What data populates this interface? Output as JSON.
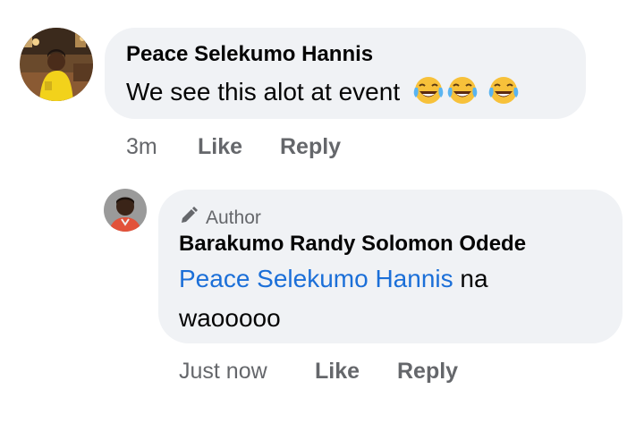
{
  "comment": {
    "author": "Peace Selekumo Hannis",
    "text": "We see this alot at event",
    "emoji_icon": "joy-face-icon",
    "emoji_count": 3,
    "time": "3m",
    "like_label": "Like",
    "reply_label": "Reply"
  },
  "reply": {
    "badge_icon": "pencil-icon",
    "badge_label": "Author",
    "author": "Barakumo Randy Solomon Odede",
    "mention": "Peace Selekumo Hannis",
    "text_after_mention": " na",
    "text_line2": "waooooo",
    "time": "Just now",
    "like_label": "Like",
    "reply_label": "Reply"
  },
  "colors": {
    "bubble_bg": "#f0f2f5",
    "mention": "#1b6fd8",
    "meta_text": "#65676b"
  }
}
